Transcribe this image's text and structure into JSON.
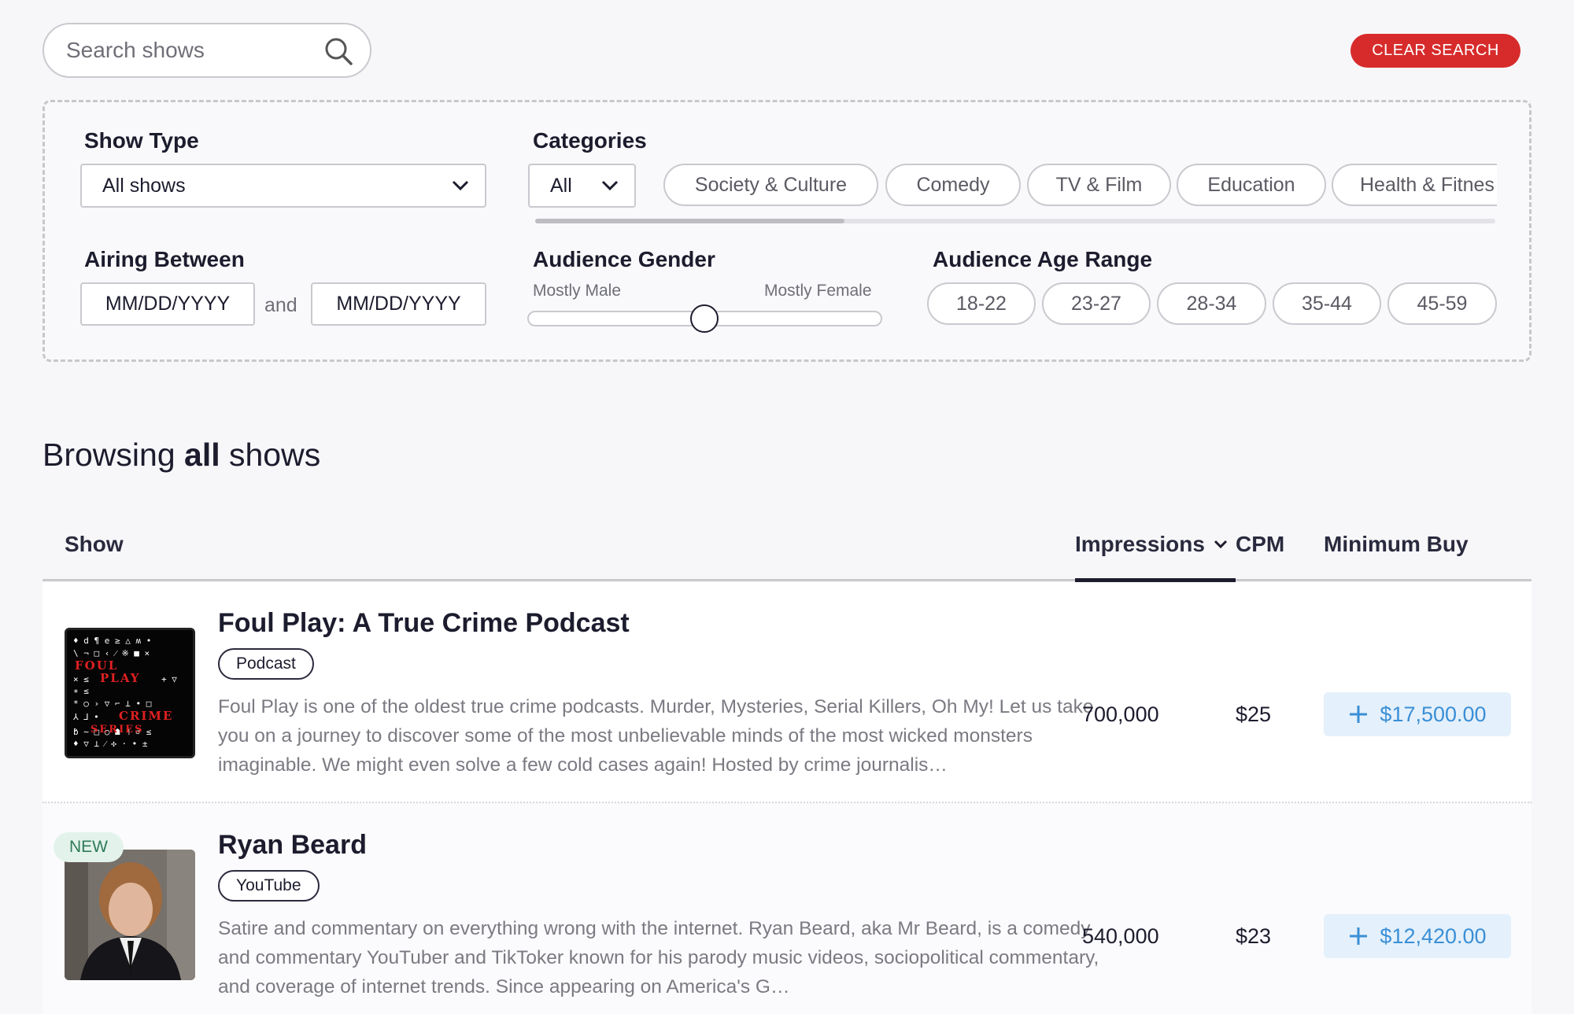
{
  "search": {
    "placeholder": "Search shows"
  },
  "clear_search_label": "CLEAR SEARCH",
  "filters": {
    "show_type": {
      "label": "Show Type",
      "selected": "All shows"
    },
    "categories": {
      "label": "Categories",
      "selected": "All",
      "options": [
        "Society & Culture",
        "Comedy",
        "TV & Film",
        "Education",
        "Health & Fitnes"
      ]
    },
    "airing_between": {
      "label": "Airing Between",
      "start_placeholder": "MM/DD/YYYY",
      "joiner": "and",
      "end_placeholder": "MM/DD/YYYY"
    },
    "audience_gender": {
      "label": "Audience Gender",
      "left_label": "Mostly Male",
      "right_label": "Mostly Female",
      "value": 0.5
    },
    "audience_age_range": {
      "label": "Audience Age Range",
      "options": [
        "18-22",
        "23-27",
        "28-34",
        "35-44",
        "45-59"
      ]
    }
  },
  "heading": {
    "prefix": "Browsing ",
    "emphasis": "all",
    "suffix": " shows"
  },
  "table": {
    "columns": {
      "show": "Show",
      "impressions": "Impressions",
      "cpm": "CPM",
      "minimum_buy": "Minimum Buy"
    },
    "rows": [
      {
        "title": "Foul Play: A True Crime Podcast",
        "type": "Podcast",
        "description": "Foul Play is one of the oldest true crime podcasts. Murder, Mysteries, Serial Killers, Oh My! Let us take you on a journey to discover some of the most unbelievable minds of the most wicked monsters imaginable. We might even solve a few cold cases again! Hosted by crime journalis…",
        "impressions": "700,000",
        "cpm": "$25",
        "minimum_buy": "$17,500.00",
        "cover_text": [
          "FOUL",
          "PLAY",
          "CRIME",
          "SERIES"
        ]
      },
      {
        "badge": "NEW",
        "title": "Ryan Beard",
        "type": "YouTube",
        "description": "Satire and commentary on everything wrong with the internet. Ryan Beard, aka Mr Beard, is a comedy and commentary YouTuber and TikToker known for his parody music videos, sociopolitical commentary, and coverage of internet trends. Since appearing on America's G…",
        "impressions": "540,000",
        "cpm": "$23",
        "minimum_buy": "$12,420.00"
      }
    ]
  },
  "colors": {
    "accent_red": "#d72b2b",
    "buy_blue": "#3a8fd6",
    "buy_bg": "#e4f0fb",
    "new_green": "#2f7a58"
  }
}
